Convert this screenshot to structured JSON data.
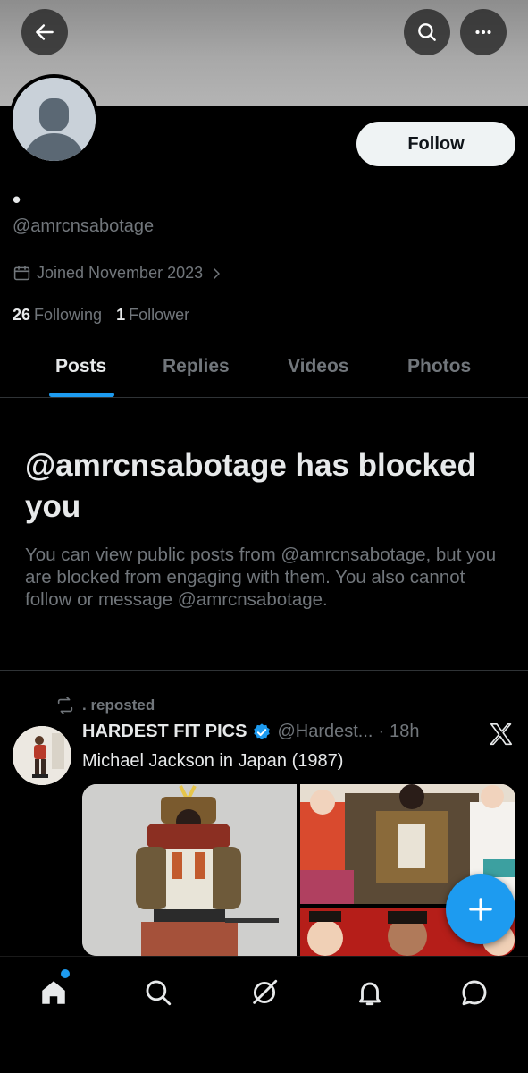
{
  "header": {
    "back_icon": "arrow-left-icon",
    "search_icon": "search-icon",
    "more_icon": "more-dots-icon"
  },
  "profile": {
    "display_name": "•",
    "handle": "@amrcnsabotage",
    "follow_label": "Follow",
    "joined": "Joined November 2023",
    "following_count": "26",
    "following_label": "Following",
    "followers_count": "1",
    "followers_label": "Follower"
  },
  "tabs": [
    {
      "label": "Posts",
      "active": true
    },
    {
      "label": "Replies",
      "active": false
    },
    {
      "label": "Videos",
      "active": false
    },
    {
      "label": "Photos",
      "active": false
    }
  ],
  "blocked": {
    "title": "@amrcnsabotage has blocked you",
    "description": "You can view public posts from @amrcnsabotage, but you are blocked from engaging with them. You also cannot follow or message @amrcnsabotage."
  },
  "post": {
    "repost_label": ". reposted",
    "author": "HARDEST FIT PICS",
    "verified": true,
    "handle": "@Hardest...",
    "separator": "·",
    "time": "18h",
    "text": "Michael Jackson in Japan (1987)"
  },
  "bottom_nav": [
    {
      "name": "home-icon",
      "has_notification": true
    },
    {
      "name": "search-icon"
    },
    {
      "name": "grok-icon"
    },
    {
      "name": "bell-icon"
    },
    {
      "name": "chat-icon"
    }
  ],
  "colors": {
    "accent": "#1d9bf0",
    "text_primary": "#e7e9ea",
    "text_secondary": "#71767b",
    "background": "#000000"
  }
}
